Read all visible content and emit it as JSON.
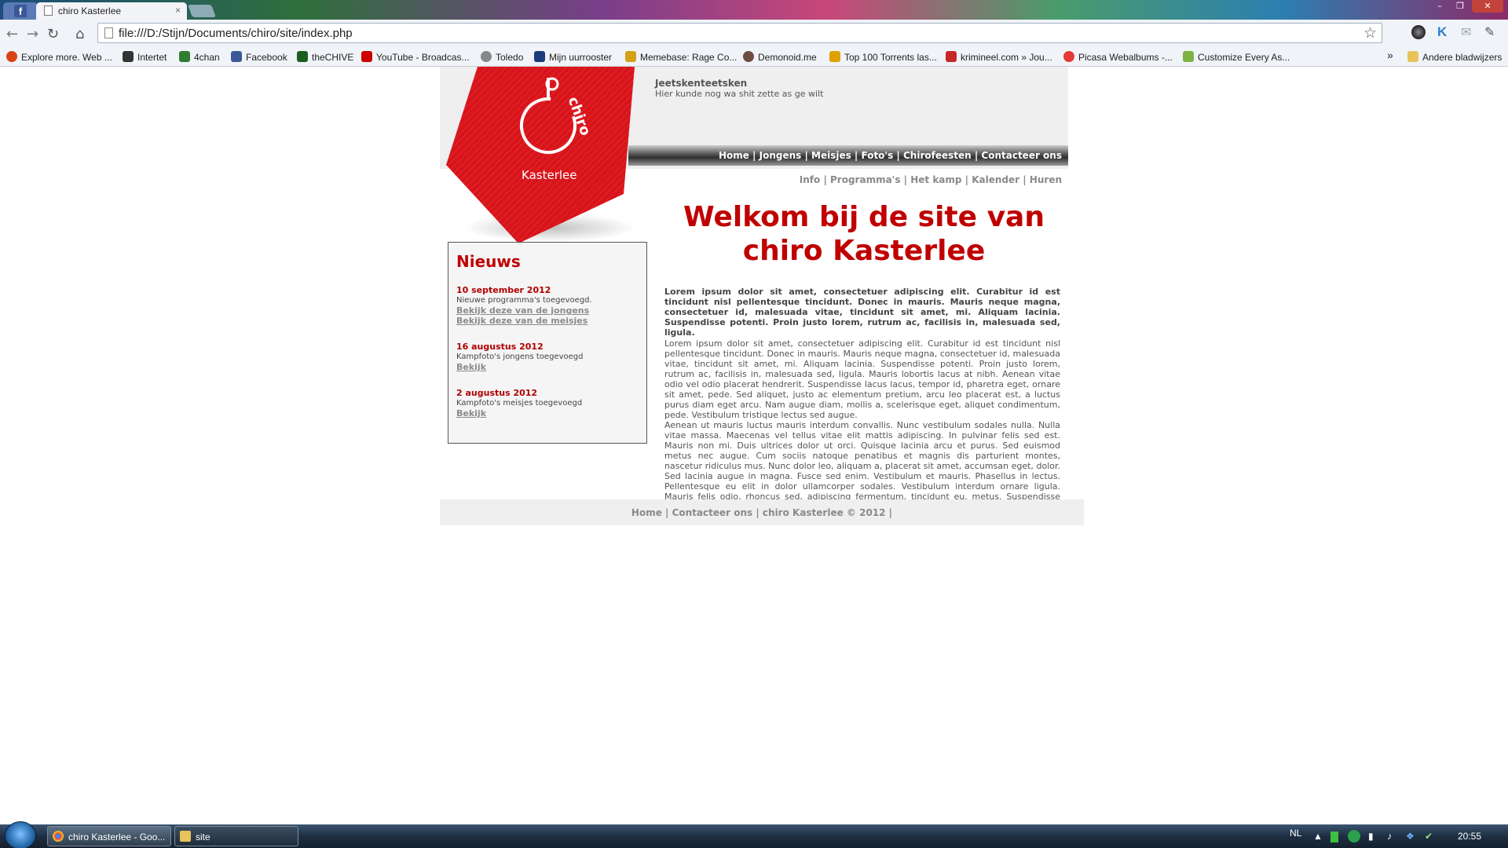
{
  "browser": {
    "tab_title": "chiro Kasterlee",
    "tab_close": "×",
    "url": "file:///D:/Stijn/Documents/chiro/site/index.php",
    "window_controls": [
      "–",
      "❐",
      "✕"
    ],
    "bookmarks": [
      {
        "label": "Explore more. Web ...",
        "color": "#d84315"
      },
      {
        "label": "Intertet",
        "color": "#333333"
      },
      {
        "label": "4chan",
        "color": "#2e7d32"
      },
      {
        "label": "Facebook",
        "color": "#3b5998"
      },
      {
        "label": "theCHIVE",
        "color": "#1b5e20"
      },
      {
        "label": "YouTube - Broadcas...",
        "color": "#cc0000"
      },
      {
        "label": "Toledo",
        "color": "#888888"
      },
      {
        "label": "Mijn uurrooster",
        "color": "#1a3c7a"
      },
      {
        "label": "Memebase: Rage Co...",
        "color": "#d4a017"
      },
      {
        "label": "Demonoid.me",
        "color": "#6d4c41"
      },
      {
        "label": "Top 100 Torrents las...",
        "color": "#e0a000"
      },
      {
        "label": "krimineel.com » Jou...",
        "color": "#c62828"
      },
      {
        "label": "Picasa Webalbums -...",
        "color": "#e53935"
      },
      {
        "label": "Customize Every As...",
        "color": "#7cb342"
      }
    ],
    "bookmarks_more": "»",
    "other_bookmarks": "Andere bladwijzers"
  },
  "site": {
    "header_title": "Jeetskenteetsken",
    "header_subtitle": "Hier kunde nog wa shit zette as ge wilt",
    "logo_word": "chiro",
    "logo_place": "Kasterlee",
    "main_nav": "Home | Jongens | Meisjes | Foto's | Chirofeesten | Contacteer ons",
    "sub_nav": "Info | Programma's | Het kamp | Kalender | Huren",
    "welcome_line1": "Welkom bij de site van",
    "welcome_line2": "chiro Kasterlee",
    "intro": "Lorem ipsum dolor sit amet, consectetuer adipiscing elit. Curabitur id est tincidunt nisl pellentesque tincidunt. Donec in mauris. Mauris neque magna, consectetuer id, malesuada vitae, tincidunt sit amet, mi. Aliquam lacinia. Suspendisse potenti. Proin justo lorem, rutrum ac, facilisis in, malesuada sed, ligula.",
    "para1": "Lorem ipsum dolor sit amet, consectetuer adipiscing elit. Curabitur id est tincidunt nisl pellentesque tincidunt. Donec in mauris. Mauris neque magna, consectetuer id, malesuada vitae, tincidunt sit amet, mi. Aliquam lacinia. Suspendisse potenti. Proin justo lorem, rutrum ac, facilisis in, malesuada sed, ligula. Mauris lobortis lacus at nibh. Aenean vitae odio vel odio placerat hendrerit. Suspendisse lacus lacus, tempor id, pharetra eget, ornare sit amet, pede. Sed aliquet, justo ac elementum pretium, arcu leo placerat est, a luctus purus diam eget arcu. Nam augue diam, mollis a, scelerisque eget, aliquet condimentum, pede. Vestibulum tristique lectus sed augue.",
    "para2": "Aenean ut mauris luctus mauris interdum convallis. Nunc vestibulum sodales nulla. Nulla vitae massa. Maecenas vel tellus vitae elit mattis adipiscing. In pulvinar felis sed est. Mauris non mi. Duis ultrices dolor ut orci. Quisque lacinia arcu et purus. Sed euismod metus nec augue. Cum sociis natoque penatibus et magnis dis parturient montes, nascetur ridiculus mus. Nunc dolor leo, aliquam a, placerat sit amet, accumsan eget, dolor. Sed lacinia augue in magna. Fusce sed enim. Vestibulum et mauris. Phasellus in lectus. Pellentesque eu elit in dolor ullamcorper sodales. Vestibulum interdum ornare ligula. Mauris felis odio, rhoncus sed, adipiscing fermentum, tincidunt eu, metus. Suspendisse viverra rhoncus purus.",
    "news_heading": "Nieuws",
    "news": [
      {
        "date": "10 september 2012",
        "text": "Nieuwe programma's toegevoegd.",
        "link1": "Bekijk deze van de jongens",
        "link2": "Bekijk deze van de meisjes"
      },
      {
        "date": "16 augustus 2012",
        "text": "Kampfoto's jongens toegevoegd",
        "link1": "Bekijk"
      },
      {
        "date": "2 augustus 2012",
        "text": "Kampfoto's meisjes toegevoegd",
        "link1": "Bekijk"
      }
    ],
    "footer": "Home | Contacteer ons | chiro Kasterlee © 2012 |",
    "accent_color": "#c00000"
  },
  "taskbar": {
    "tasks": [
      "chiro Kasterlee - Goo...",
      "site"
    ],
    "language": "NL",
    "time": "20:55"
  }
}
